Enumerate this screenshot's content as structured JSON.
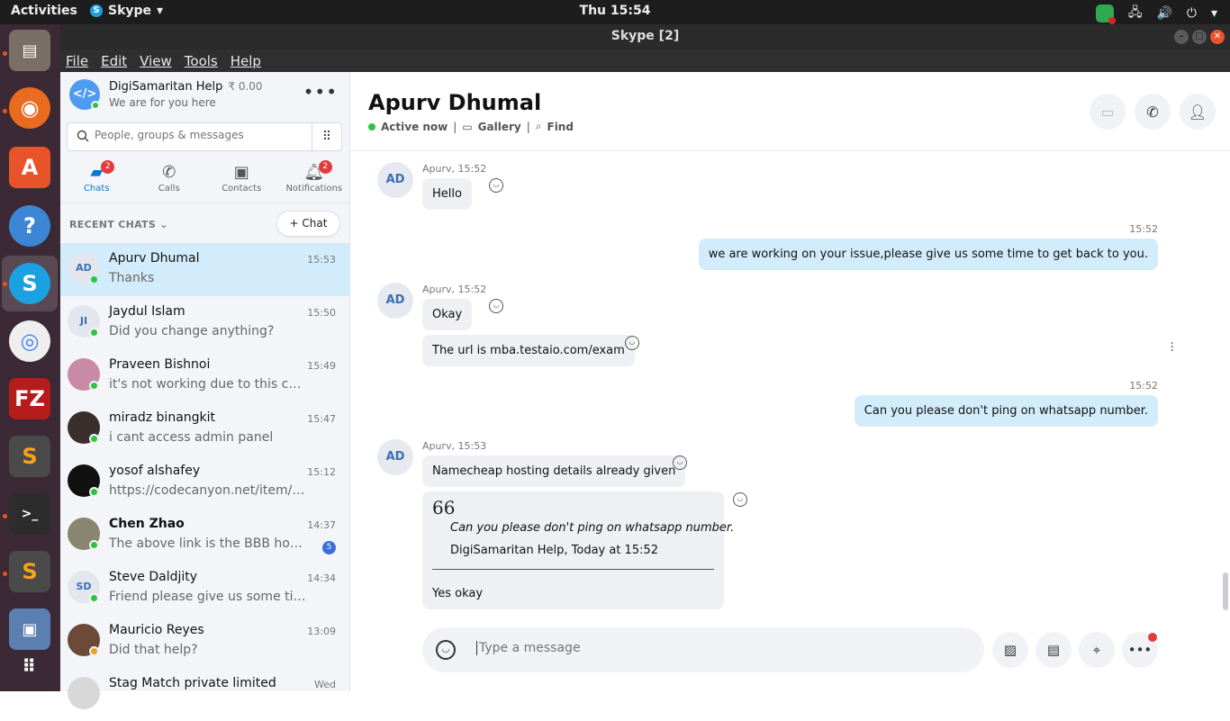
{
  "system_bar": {
    "activities": "Activities",
    "app_name": "Skype",
    "clock": "Thu 15:54"
  },
  "window": {
    "title": "Skype [2]"
  },
  "menu": [
    "File",
    "Edit",
    "View",
    "Tools",
    "Help"
  ],
  "profile": {
    "name": "DigiSamaritan Help",
    "credit": "₹ 0.00",
    "mood": "We are for you here",
    "more": "•••"
  },
  "search": {
    "placeholder": "People, groups & messages"
  },
  "nav_tabs": [
    {
      "label": "Chats",
      "icon": "chat-icon",
      "badge": "2"
    },
    {
      "label": "Calls",
      "icon": "phone-icon",
      "badge": ""
    },
    {
      "label": "Contacts",
      "icon": "contacts-icon",
      "badge": ""
    },
    {
      "label": "Notifications",
      "icon": "bell-icon",
      "badge": "2"
    }
  ],
  "recent_chats_header": "RECENT CHATS",
  "new_chat_label": "Chat",
  "chats": [
    {
      "name": "Apurv Dhumal",
      "preview": "Thanks",
      "time": "15:53",
      "initials": "AD",
      "unread": ""
    },
    {
      "name": "Jaydul Islam",
      "preview": "Did you change anything?",
      "time": "15:50",
      "initials": "JI",
      "unread": ""
    },
    {
      "name": "Praveen Bishnoi",
      "preview": "it's not working due to this change",
      "time": "15:49",
      "initials": "",
      "unread": ""
    },
    {
      "name": "miradz binangkit",
      "preview": "i cant access admin panel",
      "time": "15:47",
      "initials": "",
      "unread": ""
    },
    {
      "name": "yosof alshafey",
      "preview": "https://codecanyon.net/item/laravel",
      "time": "15:12",
      "initials": "",
      "unread": ""
    },
    {
      "name": "Chen Zhao",
      "preview": "The above link is the BBB hosting",
      "time": "14:37",
      "initials": "",
      "unread": "5"
    },
    {
      "name": "Steve Daldjity",
      "preview": "Friend please give us some time to",
      "time": "14:34",
      "initials": "SD",
      "unread": ""
    },
    {
      "name": "Mauricio Reyes",
      "preview": "Did that help?",
      "time": "13:09",
      "initials": "",
      "unread": ""
    },
    {
      "name": "Stag Match private limited",
      "preview": "",
      "time": "Wed",
      "initials": "",
      "unread": ""
    }
  ],
  "conversation": {
    "contact_name": "Apurv Dhumal",
    "status": "Active now",
    "gallery": "Gallery",
    "find": "Find",
    "messages": [
      {
        "sender": "Apurv, 15:52",
        "text": "Hello"
      },
      {
        "time": "15:52",
        "text": "we are working on your issue,please give us some time to get back to you."
      },
      {
        "sender": "Apurv, 15:52",
        "text": "Okay"
      },
      {
        "text": "The url is mba.testaio.com/exam"
      },
      {
        "time": "15:52",
        "text": "Can you please don't ping on whatsapp number."
      },
      {
        "sender": "Apurv, 15:53",
        "text": "Namecheap hosting details already given"
      }
    ],
    "avatar_initials": "AD",
    "quote": {
      "mark": "66",
      "quoted_text": "Can you please don't ping on whatsapp number.",
      "meta": "DigiSamaritan Help, Today at 15:52",
      "reply": "Yes okay"
    },
    "composer_placeholder": "Type a message"
  },
  "colors": {
    "skype_blue": "#0078d4",
    "outgoing_bubble": "#d2ecfb",
    "incoming_bubble": "#eef0f4",
    "online_green": "#2ec440",
    "badge_red": "#e23b3b"
  }
}
